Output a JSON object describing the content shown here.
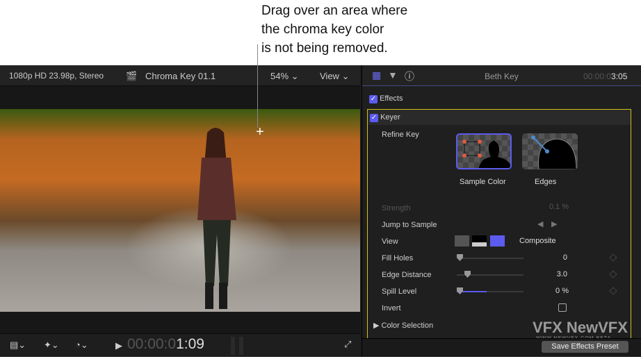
{
  "callout": {
    "lines": [
      "Drag over an area where",
      "the chroma key color",
      "is not being removed."
    ]
  },
  "viewer": {
    "format": "1080p HD 23.98p, Stereo",
    "clip_name": "Chroma Key 01.1",
    "zoom": "54%",
    "view_label": "View",
    "timecode_dim": "00:00:0",
    "timecode_bright": "1:09"
  },
  "inspector": {
    "title": "Beth Key",
    "timecode_dim": "00:00:0",
    "timecode_bright": "3:05",
    "effects_label": "Effects",
    "keyer_label": "Keyer",
    "refine_key": "Refine Key",
    "sample_color": "Sample Color",
    "edges": "Edges",
    "params": [
      {
        "label": "Strength",
        "value": "0.1",
        "unit": "%"
      },
      {
        "label": "Jump to Sample"
      },
      {
        "label": "View",
        "value": "Composite"
      },
      {
        "label": "Fill Holes",
        "value": "0",
        "level": 0
      },
      {
        "label": "Edge Distance",
        "value": "3.0",
        "level": 0.12
      },
      {
        "label": "Spill Level",
        "value": "0",
        "unit": "%",
        "level": 0.45
      },
      {
        "label": "Invert",
        "checked": false
      }
    ],
    "color_selection": "Color Selection",
    "save_preset": "Save Effects Preset"
  },
  "watermark": {
    "brand": "NewVFX 社区",
    "url": "WWW.NEWVFX.COM BETA"
  },
  "colors": {
    "accent": "#5b5bf0",
    "keyer_border": "#d4c21a"
  }
}
